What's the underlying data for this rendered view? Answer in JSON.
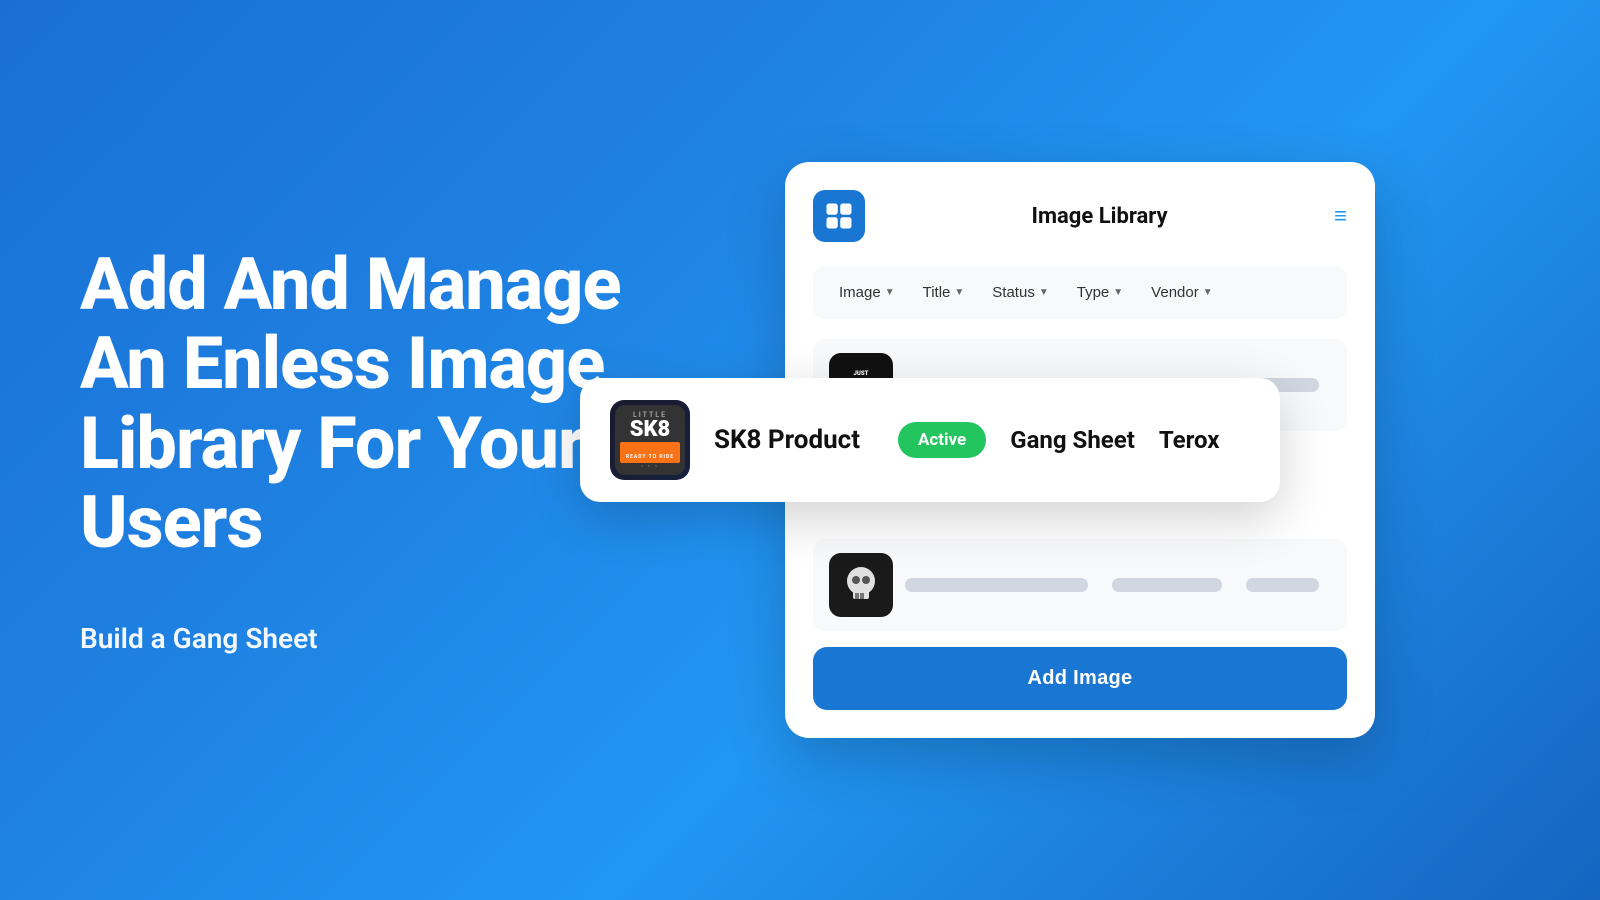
{
  "background": {
    "colors": {
      "from": "#1a6fd4",
      "to": "#1565c0"
    }
  },
  "left": {
    "main_heading": "Add And Manage An Enless Image Library For Your Users",
    "sub_heading": "Build a Gang Sheet"
  },
  "card": {
    "title": "Image Library",
    "logo_alt": "app-logo",
    "menu_icon": "≡",
    "filters": [
      {
        "label": "Image",
        "id": "image-filter"
      },
      {
        "label": "Title",
        "id": "title-filter"
      },
      {
        "label": "Status",
        "id": "status-filter"
      },
      {
        "label": "Type",
        "id": "type-filter"
      },
      {
        "label": "Vendor",
        "id": "vendor-filter"
      }
    ],
    "rows": [
      {
        "id": "row-1",
        "image_type": "jkf",
        "has_data": false
      },
      {
        "id": "row-highlighted",
        "image_type": "sk8",
        "has_data": true,
        "title": "SK8 Product",
        "status": "Active",
        "type": "Gang Sheet",
        "vendor": "Terox"
      },
      {
        "id": "row-3",
        "image_type": "skull",
        "has_data": false
      }
    ],
    "add_button_label": "Add Image",
    "accent_color": "#1976d2",
    "status_color": "#22c55e"
  }
}
